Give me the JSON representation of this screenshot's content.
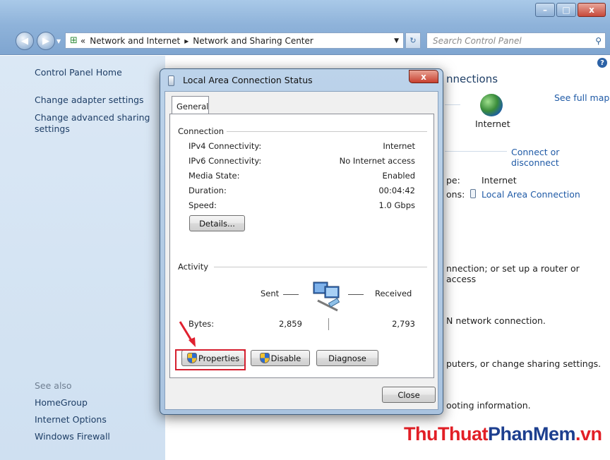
{
  "window": {
    "controls": {
      "minimize": "–",
      "maximize": "□",
      "close": "x"
    }
  },
  "address_bar": {
    "prefix": "«",
    "segments": [
      "Network and Internet",
      "Network and Sharing Center"
    ],
    "separator": "▸",
    "search_placeholder": "Search Control Panel"
  },
  "left_pane": {
    "home": "Control Panel Home",
    "links": [
      "Change adapter settings",
      "Change advanced sharing",
      "settings"
    ],
    "see_also_title": "See also",
    "see_also": [
      "HomeGroup",
      "Internet Options",
      "Windows Firewall"
    ]
  },
  "main_pane": {
    "heading_fragment": "nnections",
    "see_full_map": "See full map",
    "internet_label": "Internet",
    "connect_disconnect": "Connect or disconnect",
    "access_type_fragment": "pe:",
    "access_type_value": "Internet",
    "connections_fragment": "ons:",
    "connections_value": "Local Area Connection",
    "task1": "nnection; or set up a router or access",
    "task2": "N network connection.",
    "task3": "puters, or change sharing settings.",
    "task4": "ooting information."
  },
  "dialog": {
    "title": "Local Area Connection Status",
    "tab": "General",
    "connection_group": "Connection",
    "rows": [
      {
        "label": "IPv4 Connectivity:",
        "value": "Internet"
      },
      {
        "label": "IPv6 Connectivity:",
        "value": "No Internet access"
      },
      {
        "label": "Media State:",
        "value": "Enabled"
      },
      {
        "label": "Duration:",
        "value": "00:04:42"
      },
      {
        "label": "Speed:",
        "value": "1.0 Gbps"
      }
    ],
    "details_button": "Details...",
    "activity_group": "Activity",
    "sent_label": "Sent",
    "received_label": "Received",
    "bytes_label": "Bytes:",
    "bytes_sent": "2,859",
    "bytes_received": "2,793",
    "properties_button": "Properties",
    "disable_button": "Disable",
    "diagnose_button": "Diagnose",
    "close_button": "Close"
  },
  "watermark": {
    "part1": "ThuThuat",
    "part2": "PhanMem",
    "part3": ".vn"
  },
  "colors": {
    "accent_highlight": "#d6202f",
    "link": "#1f5aa6"
  }
}
